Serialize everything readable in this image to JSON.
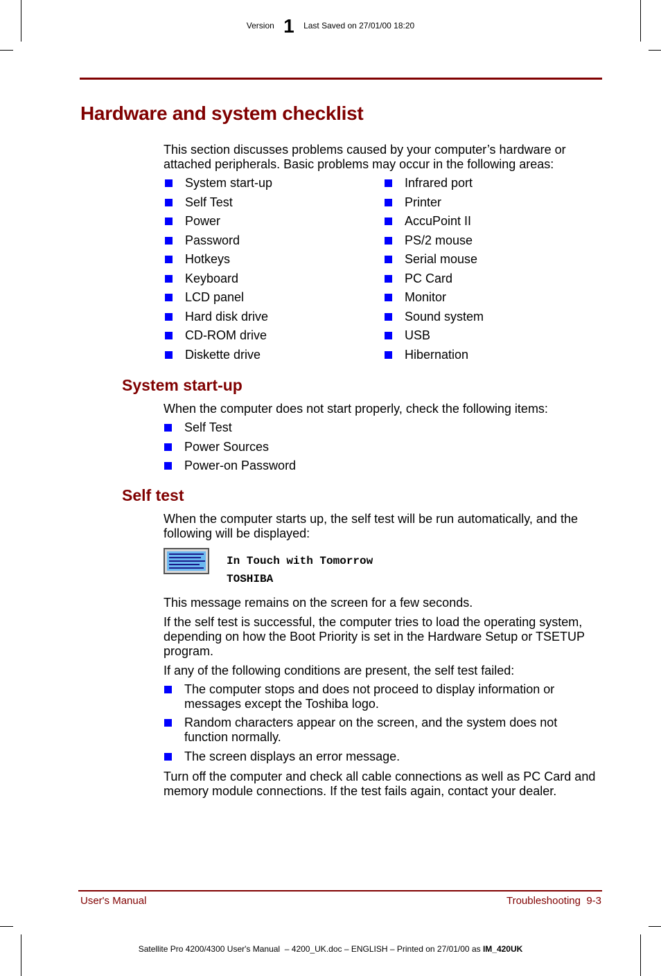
{
  "header": {
    "version_label": "Version",
    "version_number": "1",
    "last_saved": "Last Saved on 27/01/00 18:20"
  },
  "page_title": "Hardware and system checklist",
  "intro": "This section discusses problems caused by your computer’s hardware or attached peripherals. Basic problems may occur in the following areas:",
  "areas_left": [
    "System start-up",
    "Self Test",
    "Power",
    "Password",
    "Hotkeys",
    "Keyboard",
    "LCD panel",
    "Hard disk drive",
    "CD-ROM drive",
    "Diskette drive"
  ],
  "areas_right": [
    "Infrared port",
    "Printer",
    "AccuPoint II",
    "PS/2 mouse",
    "Serial mouse",
    "PC Card",
    "Monitor",
    "Sound system",
    "USB",
    "Hibernation"
  ],
  "startup": {
    "heading": "System start-up",
    "intro": "When the computer does not start properly, check the following items:",
    "items": [
      "Self Test",
      "Power Sources",
      "Power-on Password"
    ]
  },
  "selftest": {
    "heading": "Self test",
    "intro": "When the computer starts up, the self test will be run automatically, and the following will be displayed:",
    "screen_icon": "screen-icon",
    "screen_line1": "In Touch with Tomorrow",
    "screen_line2": "TOSHIBA",
    "p1": "This message remains on the screen for a few seconds.",
    "p2": "If the self test is successful, the computer tries to load the operating system, depending on how the Boot Priority is set in the Hardware Setup or TSETUP program.",
    "p3": "If any of the following conditions are present, the self test failed:",
    "conditions": [
      "The computer stops and does not proceed to display information or messages except the Toshiba logo.",
      "Random characters appear on the screen, and the system does not function normally.",
      "The screen displays an error message."
    ],
    "p4": "Turn off the computer and check all cable connections as well as PC Card and memory module connections. If the test fails again, contact your dealer."
  },
  "footer": {
    "left": "User's Manual",
    "right": "Troubleshooting  9-3",
    "print_line": "Satellite Pro 4200/4300 User's Manual  – 4200_UK.doc – ENGLISH – Printed on 27/01/00 as ",
    "print_code": "IM_420UK"
  },
  "colors": {
    "heading": "#800000",
    "bullet": "#0000ff"
  }
}
